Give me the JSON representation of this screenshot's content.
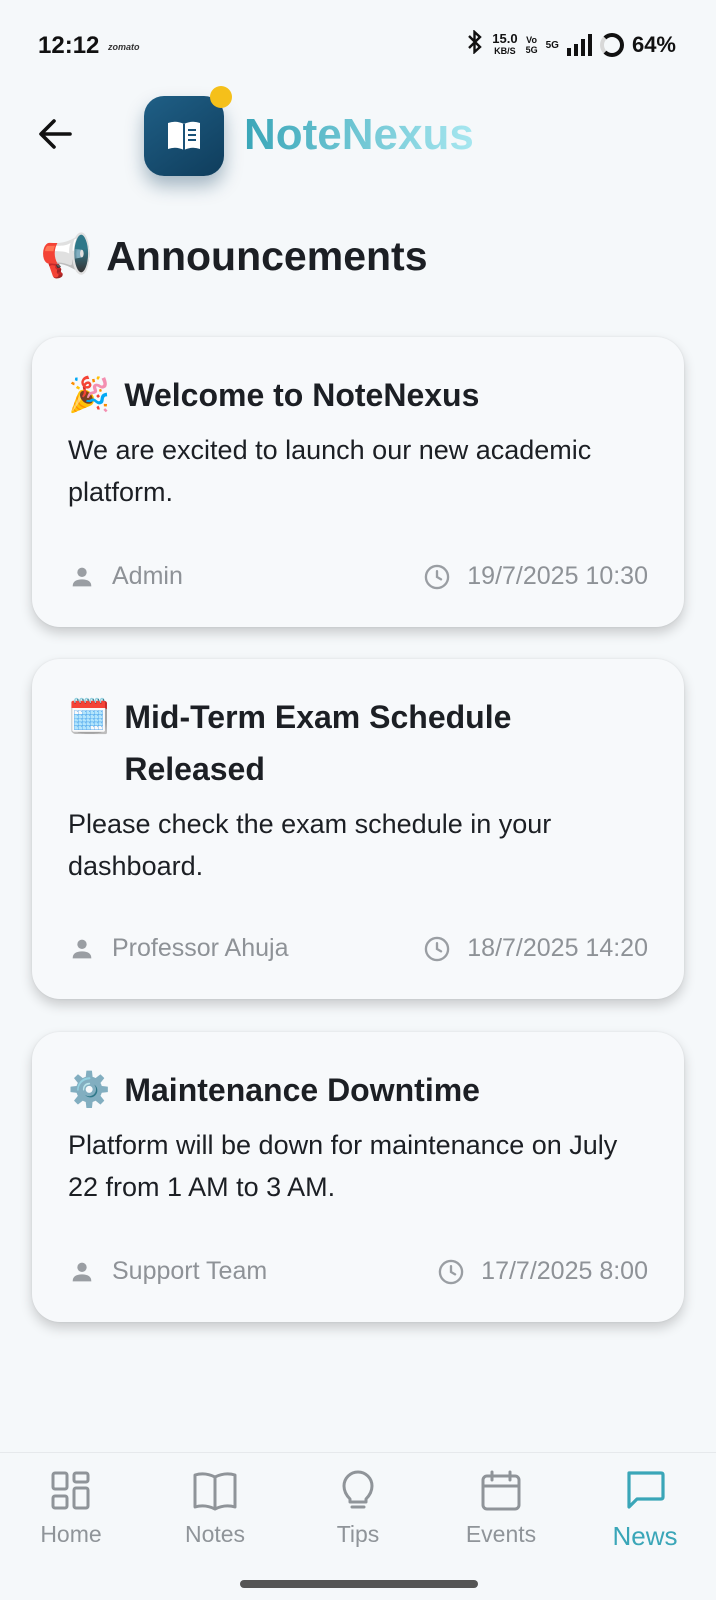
{
  "status_bar": {
    "time": "12:12",
    "brand": "zomato",
    "speed_value": "15.0",
    "speed_unit": "KB/S",
    "vo_top": "Vo",
    "vo_bottom": "5G",
    "network": "5G",
    "battery": "64%"
  },
  "header": {
    "app_name": "NoteNexus"
  },
  "page": {
    "title_emoji": "📢",
    "title": "Announcements"
  },
  "announcements": [
    {
      "emoji": "🎉",
      "title": "Welcome to NoteNexus",
      "body": "We are excited to launch our new academic platform.",
      "author": "Admin",
      "timestamp": "19/7/2025 10:30"
    },
    {
      "emoji": "🗓️",
      "title": "Mid-Term Exam Schedule Released",
      "body": "Please check the exam schedule in your dashboard.",
      "author": "Professor Ahuja",
      "timestamp": "18/7/2025 14:20"
    },
    {
      "emoji": "⚙️",
      "title": "Maintenance Downtime",
      "body": "Platform will be down for maintenance on July 22 from 1 AM to 3 AM.",
      "author": "Support Team",
      "timestamp": "17/7/2025 8:00"
    }
  ],
  "nav": {
    "items": [
      {
        "label": "Home",
        "icon": "grid-icon"
      },
      {
        "label": "Notes",
        "icon": "book-icon"
      },
      {
        "label": "Tips",
        "icon": "lightbulb-icon"
      },
      {
        "label": "Events",
        "icon": "calendar-icon"
      },
      {
        "label": "News",
        "icon": "chat-bubble-icon"
      }
    ],
    "active": "News"
  },
  "colors": {
    "accent": "#3aa6b8",
    "logo_bg": "#1a5278",
    "logo_dot": "#f5c01a",
    "muted": "#8e9297"
  }
}
